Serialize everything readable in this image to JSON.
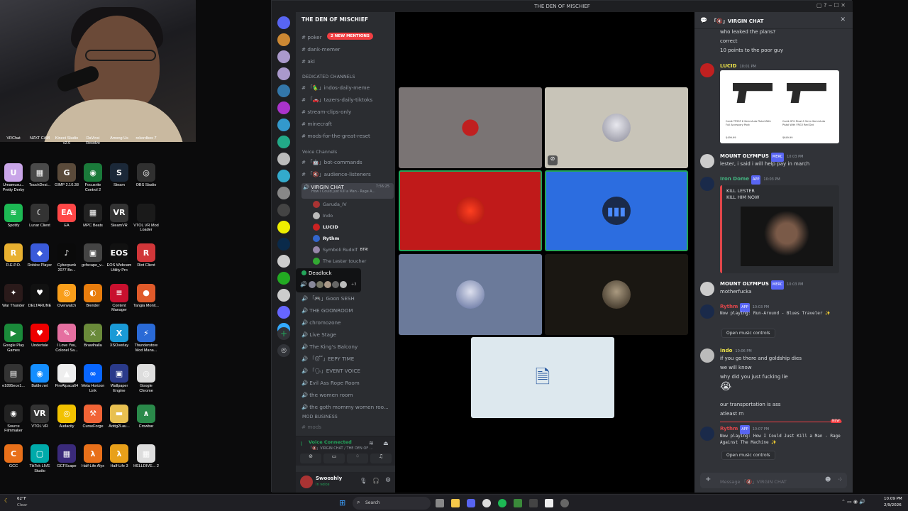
{
  "webcam": {},
  "desktop_icons": [
    {
      "label": "VRChat",
      "color": "#2a2a2a",
      "glyph": ""
    },
    {
      "label": "NZXT CAM",
      "color": "#2a2a2a",
      "glyph": ""
    },
    {
      "label": "Kinect Studio v2.0",
      "color": "#2a2a2a",
      "glyph": ""
    },
    {
      "label": "DaVinci Resolve",
      "color": "#2a2a2a",
      "glyph": ""
    },
    {
      "label": "Among Us",
      "color": "#2a2a2a",
      "glyph": ""
    },
    {
      "label": "rekordbox 7",
      "color": "#2a2a2a",
      "glyph": ""
    },
    {
      "label": "Umamusu... Pretty Derby",
      "color": "#c9a5e8",
      "glyph": "U"
    },
    {
      "label": "TouchDesi...",
      "color": "#4a4a4a",
      "glyph": "▦"
    },
    {
      "label": "GIMP 2.10.38",
      "color": "#5a4a3a",
      "glyph": "G"
    },
    {
      "label": "Focusrite Control 2",
      "color": "#1a7a3a",
      "glyph": "◉"
    },
    {
      "label": "Steam",
      "color": "#1b2838",
      "glyph": "S"
    },
    {
      "label": "OBS Studio",
      "color": "#303030",
      "glyph": "◎"
    },
    {
      "label": "Spotify",
      "color": "#1db954",
      "glyph": "≋"
    },
    {
      "label": "Lunar Client",
      "color": "#333",
      "glyph": "☾"
    },
    {
      "label": "EA",
      "color": "#ff4747",
      "glyph": "EA"
    },
    {
      "label": "MPC Beats",
      "color": "#222",
      "glyph": "▦"
    },
    {
      "label": "SteamVR",
      "color": "#333",
      "glyph": "VR"
    },
    {
      "label": "VTOL VR Mod Loader",
      "color": "#1a1a1a",
      "glyph": ""
    },
    {
      "label": "R.E.P.O.",
      "color": "#e8b030",
      "glyph": "R"
    },
    {
      "label": "Roblox Player",
      "color": "#3a5ad9",
      "glyph": "◆"
    },
    {
      "label": "Cyberpunk 2077 Bo...",
      "color": "#0a0a0a",
      "glyph": "♪"
    },
    {
      "label": "gcfscape_v...",
      "color": "#444",
      "glyph": "▣"
    },
    {
      "label": "EOS Webcam Utility Pro",
      "color": "#111",
      "glyph": "EOS"
    },
    {
      "label": "Riot Client",
      "color": "#d13639",
      "glyph": "R"
    },
    {
      "label": "War Thunder",
      "color": "#2a1a1a",
      "glyph": "✦"
    },
    {
      "label": "DELTARUNE",
      "color": "#111",
      "glyph": "♥"
    },
    {
      "label": "Overwatch",
      "color": "#f99e1a",
      "glyph": "◎"
    },
    {
      "label": "Blender",
      "color": "#e87d0d",
      "glyph": "◐"
    },
    {
      "label": "Content Manager",
      "color": "#c8102e",
      "glyph": "≡"
    },
    {
      "label": "Tangia Monit...",
      "color": "#e05a2a",
      "glyph": "●"
    },
    {
      "label": "Google Play Games",
      "color": "#1a8a3a",
      "glyph": "▶"
    },
    {
      "label": "Undertale",
      "color": "#e00",
      "glyph": "♥"
    },
    {
      "label": "I Love You, Colonel Sa...",
      "color": "#e56fa0",
      "glyph": "✎"
    },
    {
      "label": "Brawlhalla",
      "color": "#6a8a3a",
      "glyph": "⚔"
    },
    {
      "label": "XSOverlay",
      "color": "#1a9ad6",
      "glyph": "X"
    },
    {
      "label": "Thunderstore Mod Mana...",
      "color": "#2a6ad6",
      "glyph": "⚡"
    },
    {
      "label": "e1895ece1...",
      "color": "#333",
      "glyph": "▤"
    },
    {
      "label": "Battle.net",
      "color": "#148eff",
      "glyph": "◉"
    },
    {
      "label": "FireAlpaca64",
      "color": "#eee",
      "glyph": "▲"
    },
    {
      "label": "Meta Horizon Link",
      "color": "#0866ff",
      "glyph": "∞"
    },
    {
      "label": "Wallpaper Engine",
      "color": "#2a3a8a",
      "glyph": "▣"
    },
    {
      "label": "Google Chrome",
      "color": "#ddd",
      "glyph": "◎"
    },
    {
      "label": "Source Filmmaker",
      "color": "#222",
      "glyph": "◉"
    },
    {
      "label": "VTOL VR",
      "color": "#333",
      "glyph": "VR"
    },
    {
      "label": "Audacity",
      "color": "#f2c200",
      "glyph": "◎"
    },
    {
      "label": "CurseForge",
      "color": "#f16436",
      "glyph": "⚒"
    },
    {
      "label": "Aottg2Lau...",
      "color": "#e8c050",
      "glyph": "▬"
    },
    {
      "label": "Crowbar",
      "color": "#2a8a4a",
      "glyph": "∧"
    },
    {
      "label": "GCC",
      "color": "#e8701a",
      "glyph": "C"
    },
    {
      "label": "TikTok LIVE Studio",
      "color": "#0aa",
      "glyph": "▢"
    },
    {
      "label": "GCFScape",
      "color": "#3a2a7a",
      "glyph": "▦"
    },
    {
      "label": "Half-Life Alyx",
      "color": "#e8701a",
      "glyph": "λ"
    },
    {
      "label": "Half-Life 3",
      "color": "#e8a01a",
      "glyph": "λ"
    },
    {
      "label": "HELLDIVE... 2",
      "color": "#ddd",
      "glyph": "▦"
    }
  ],
  "discord": {
    "window_title": "THE DEN OF MISCHIEF",
    "server_name": "THE DEN OF MISCHIEF",
    "mentions_pill": "2 NEW MENTIONS",
    "top_channels": [
      "poker",
      "dank-memer",
      "aki"
    ],
    "categories": {
      "dedicated": "DEDICATED CHANNELS",
      "voice": "Voice Channels",
      "mod": "MOD BUSINESS"
    },
    "dedicated_channels": [
      "「🦜」indos-daily-meme",
      "「🚗」tazers-daily-tiktoks",
      "stream-clips-only",
      "minecraft",
      "mods-for-the-great-reset"
    ],
    "voice_text_channels": [
      "「🤖」bot-commands",
      "「🔇」audience-listeners"
    ],
    "active_voice": {
      "name": "VIRGIN CHAT",
      "timer": "7:56:25",
      "activity": "How I Could Just Kill a Man - Rage A..."
    },
    "voice_users": [
      "Garuda_IV",
      "Indo",
      "LUCID",
      "Rythm",
      "Symboli Rudolf",
      "The Lester toucher"
    ],
    "bot_tag": "BTR!",
    "tooltip": {
      "title": "Deadlock",
      "extra": "+3"
    },
    "more_voice": [
      "「🎮」Goon SESH",
      "THE GOONROOM",
      "chromozone",
      "Live Stage",
      "The King's Balcony",
      "「😴」EEPY TIME",
      "「🗣」EVENT VOICE",
      "Evil Ass Rope Room",
      "the women room",
      "the goth mommy women roo..."
    ],
    "mod_channel": "mods",
    "voice_connected": {
      "status": "Voice Connected",
      "channel": "「🔇」VIRGIN CHAT / THE DEN OF ..."
    },
    "user": {
      "name": "Swooshly",
      "status": "In voice"
    },
    "chat": {
      "title": "「🔇」VIRGIN CHAT",
      "lines_top": [
        "who leaked the plans?",
        "correct",
        "10 points to the poor guy"
      ],
      "messages": [
        {
          "user": "LUCID",
          "time": "10:01 PM",
          "color": "#f0e64a"
        },
        {
          "user": "MOUNT OLYMPUS",
          "time": "10:03 PM",
          "tag": "MERC",
          "text": "lester, i said i will help pay in march",
          "color": "#ffffff"
        },
        {
          "user": "Iron Dome",
          "time": "10:03 PM",
          "tag": "APP",
          "color": "#43b581",
          "embed": "KILL LESTER\nKILL HIM NOW"
        },
        {
          "user": "MOUNT OLYMPUS",
          "time": "10:03 PM",
          "tag": "MERC",
          "text": "motherfucka",
          "color": "#ffffff"
        },
        {
          "user": "Rythm",
          "time": "10:03 PM",
          "tag": "APP",
          "text": "Now playing: Run-Around - Blues Traveler ✨",
          "color": "#e0464a"
        },
        {
          "user": "Indo",
          "time": "10:06 PM",
          "color": "#f0e64a",
          "lines": [
            "if you go there and goldship dies",
            "we will know",
            "why did you just fucking lie",
            "😭",
            "our transportation is ass",
            "atleast rn"
          ]
        },
        {
          "user": "Rythm",
          "time": "10:07 PM",
          "tag": "APP",
          "text": "Now playing: How I Could Just Kill a Man - Rage Against The Machine ✨",
          "color": "#e0464a"
        }
      ],
      "product_caption_1": "Canik TP9SF K Semi-Auto Pistol With Full Accessory Pack",
      "product_caption_2": "Canik SFX Rival-S 9mm Semi-Auto Pistol With FRG3 Red Dot",
      "product_price_1": "$499.99",
      "product_price_2": "$649.99",
      "open_controls": "Open music controls",
      "new_badge": "NEW",
      "input_placeholder": "Message 「🔇」VIRGIN CHAT"
    }
  },
  "taskbar": {
    "weather_temp": "62°F",
    "weather_desc": "Clear",
    "search": "Search",
    "time": "10:09 PM",
    "date": "2/9/2026"
  }
}
